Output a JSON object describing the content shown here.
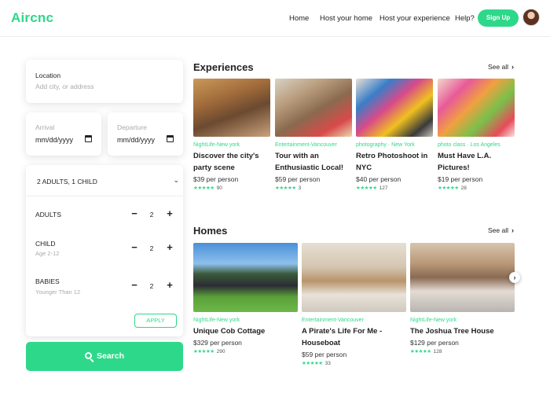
{
  "header": {
    "logo": "Aircnc",
    "nav": [
      "Home",
      "Host your home",
      "Host your experience",
      "Help?"
    ],
    "signup": "Sign Up"
  },
  "search_panel": {
    "location": {
      "label": "Location",
      "placeholder": "Add city, or address"
    },
    "arrival": {
      "label": "Arrival",
      "value": "mm/dd/yyyy"
    },
    "departure": {
      "label": "Departure",
      "value": "mm/dd/yyyy"
    },
    "guests_summary": "2 ADULTS, 1 CHILD",
    "guests": [
      {
        "name": "ADULTS",
        "sub": "",
        "count": "2"
      },
      {
        "name": "CHILD",
        "sub": "Age 2-12",
        "count": "2"
      },
      {
        "name": "BABIES",
        "sub": "Younger Than 12",
        "count": "2"
      }
    ],
    "apply": "APPLY",
    "search": "Search"
  },
  "experiences": {
    "title": "Experiences",
    "see_all": "See all",
    "items": [
      {
        "tag": "NightLife-New york",
        "title": "Discover the city's party scene",
        "price": "$39 per person",
        "reviews": "90"
      },
      {
        "tag": "Entertainment-Vancouver",
        "title": "Tour with an Enthusiastic Local!",
        "price": "$59 per person",
        "reviews": "3"
      },
      {
        "tag": "photography · New York",
        "title": "Retro Photoshoot in NYC",
        "price": "$40 per person",
        "reviews": "127"
      },
      {
        "tag": "photo class · Los Angeles",
        "title": "Must Have L.A. Pictures!",
        "price": "$19 per person",
        "reviews": "28"
      }
    ]
  },
  "homes": {
    "title": "Homes",
    "see_all": "See all",
    "items": [
      {
        "tag": "NightLife-New york",
        "title": "Unique Cob Cottage",
        "price": "$329 per person",
        "reviews": "290"
      },
      {
        "tag": "Entertainment-Vancouver",
        "title": "A Pirate's Life For Me - Houseboat",
        "price": "$59 per person",
        "reviews": "33"
      },
      {
        "tag": "NightLife-New york",
        "title": "The Joshua Tree House",
        "price": "$129 per person",
        "reviews": "128"
      }
    ]
  },
  "icons": {
    "stars": "★★★★★",
    "chevron_right": "›",
    "chevron_down": "⌄",
    "minus": "−",
    "plus": "+"
  },
  "colors": {
    "accent": "#2ed88a"
  }
}
